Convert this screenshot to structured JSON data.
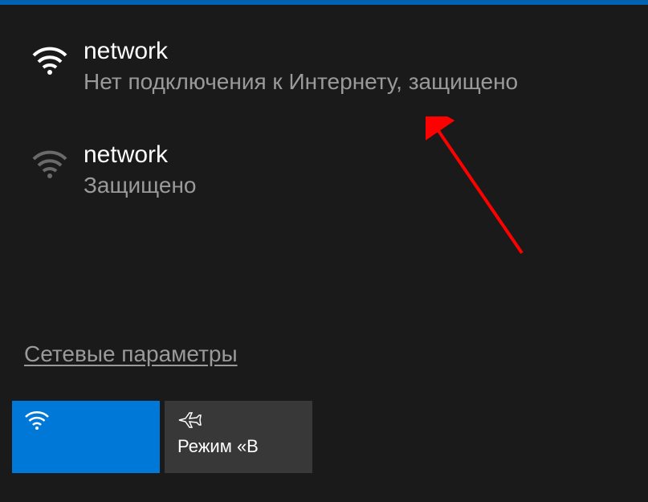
{
  "networks": [
    {
      "name": "network",
      "status": "Нет подключения к Интернету, защищено",
      "connected": true
    },
    {
      "name": "network",
      "status": "Защищено",
      "connected": false
    }
  ],
  "settings_link": "Сетевые параметры",
  "tiles": {
    "wifi": {
      "label": ""
    },
    "airplane": {
      "label": "Режим «В"
    }
  },
  "colors": {
    "accent": "#0078d7",
    "background": "#1a1a1a",
    "tile_inactive": "#383838"
  }
}
